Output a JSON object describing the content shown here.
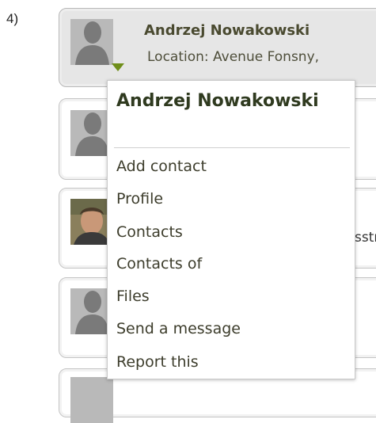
{
  "step_label": "4)",
  "selected_card": {
    "name": "Andrzej Nowakowski",
    "location": "Location: Avenue Fonsny,"
  },
  "peek_text": "sstr",
  "menu": {
    "title": "Andrzej Nowakowski",
    "items": [
      "Add contact",
      "Profile",
      "Contacts",
      "Contacts of",
      "Files",
      "Send a message",
      "Report this"
    ]
  },
  "colors": {
    "accent": "#6f8e1a",
    "selected_card_bg": "#e6e6e6",
    "avatar_placeholder": "#b9b9b9"
  }
}
